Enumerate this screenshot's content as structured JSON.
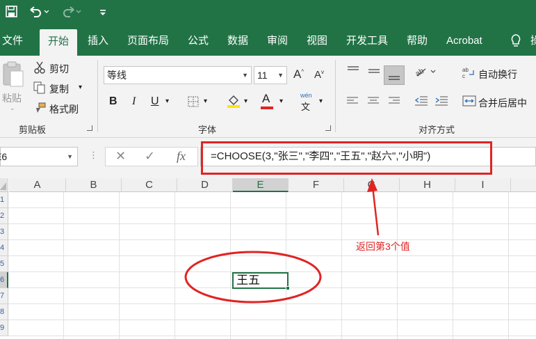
{
  "quick_access": {
    "save_icon": "save-icon",
    "undo_icon": "undo-icon",
    "redo_icon": "redo-icon"
  },
  "tabs": [
    {
      "label": "文件"
    },
    {
      "label": "开始",
      "active": true
    },
    {
      "label": "插入"
    },
    {
      "label": "页面布局"
    },
    {
      "label": "公式"
    },
    {
      "label": "数据"
    },
    {
      "label": "审阅"
    },
    {
      "label": "视图"
    },
    {
      "label": "开发工具"
    },
    {
      "label": "帮助"
    },
    {
      "label": "Acrobat"
    },
    {
      "label": "操"
    }
  ],
  "ribbon": {
    "clipboard": {
      "paste_label": "粘贴",
      "cut_label": "剪切",
      "copy_label": "复制",
      "format_painter_label": "格式刷",
      "group_label": "剪贴板"
    },
    "font": {
      "font_name": "等线",
      "font_size": "11",
      "bold": "B",
      "italic": "I",
      "underline": "U",
      "font_color": "A",
      "phonetic": "wén",
      "group_label": "字体"
    },
    "alignment": {
      "wrap_text_label": "自动换行",
      "merge_center_label": "合并后居中",
      "group_label": "对齐方式"
    }
  },
  "formula_bar": {
    "name_box": "E6",
    "fx_label": "fx",
    "formula": "=CHOOSE(3,\"张三\",\"李四\",\"王五\",\"赵六\",\"小明\")"
  },
  "grid": {
    "columns": [
      "D",
      "E",
      "F",
      "G",
      "H",
      "I"
    ],
    "first_columns": [
      "A",
      "B",
      "C"
    ],
    "selected_column": "E",
    "row_labels": [
      "1",
      "2",
      "3",
      "4",
      "5",
      "6",
      "7",
      "8",
      "9"
    ],
    "selected_row": "6",
    "active_cell_value": "王五"
  },
  "annotation": {
    "text": "返回第3个值",
    "color": "#e02424"
  },
  "colors": {
    "brand": "#217346",
    "ribbon_bg": "#f3f3f3"
  }
}
